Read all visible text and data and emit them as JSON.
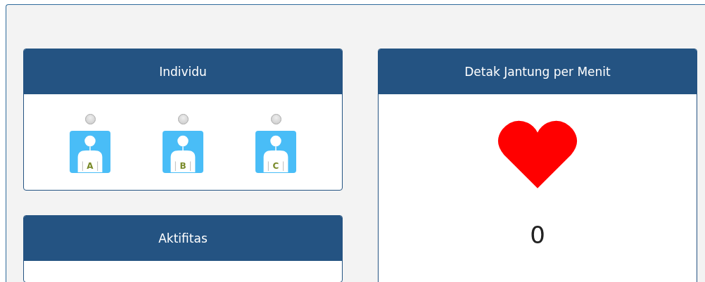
{
  "individu_panel": {
    "title": "Individu",
    "persons": [
      {
        "label": "A",
        "selected": false
      },
      {
        "label": "B",
        "selected": false
      },
      {
        "label": "C",
        "selected": false
      }
    ]
  },
  "aktifitas_panel": {
    "title": "Aktifitas"
  },
  "heart_rate_panel": {
    "title": "Detak Jantung per Menit",
    "value": "0"
  }
}
